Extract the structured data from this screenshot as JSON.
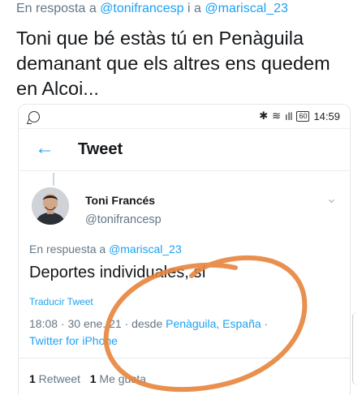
{
  "outer": {
    "reply_prefix": "En resposta a ",
    "mention1": "@tonifrancesp",
    "reply_join": " i a ",
    "mention2": "@mariscal_23",
    "text": "Toni que bé estàs tú en Penàguila demanant que els altres ens quedem en Alcoi..."
  },
  "statusbar": {
    "signal": "ıll",
    "battery": "60",
    "time": "14:59"
  },
  "app_header": {
    "back_icon": "arrow-left-icon",
    "title": "Tweet"
  },
  "tweet": {
    "author_name": "Toni Francés",
    "author_handle": "@tonifrancesp",
    "reply_prefix": "En respuesta a ",
    "reply_mention": "@mariscal_23",
    "text": "Deportes individuales, sí",
    "translate_label": "Traducir Tweet",
    "datetime": "18:08 · 30 ene. 21 · desde ",
    "location": "Penàguila, España",
    "location_sep": " ·",
    "client": "Twitter for iPhone",
    "retweet_count": "1",
    "retweet_label": " Retweet",
    "like_count": "1",
    "like_label": " Me gusta"
  },
  "colors": {
    "accent": "#1da1f2",
    "muted": "#657786",
    "annotation": "#e8843c"
  }
}
